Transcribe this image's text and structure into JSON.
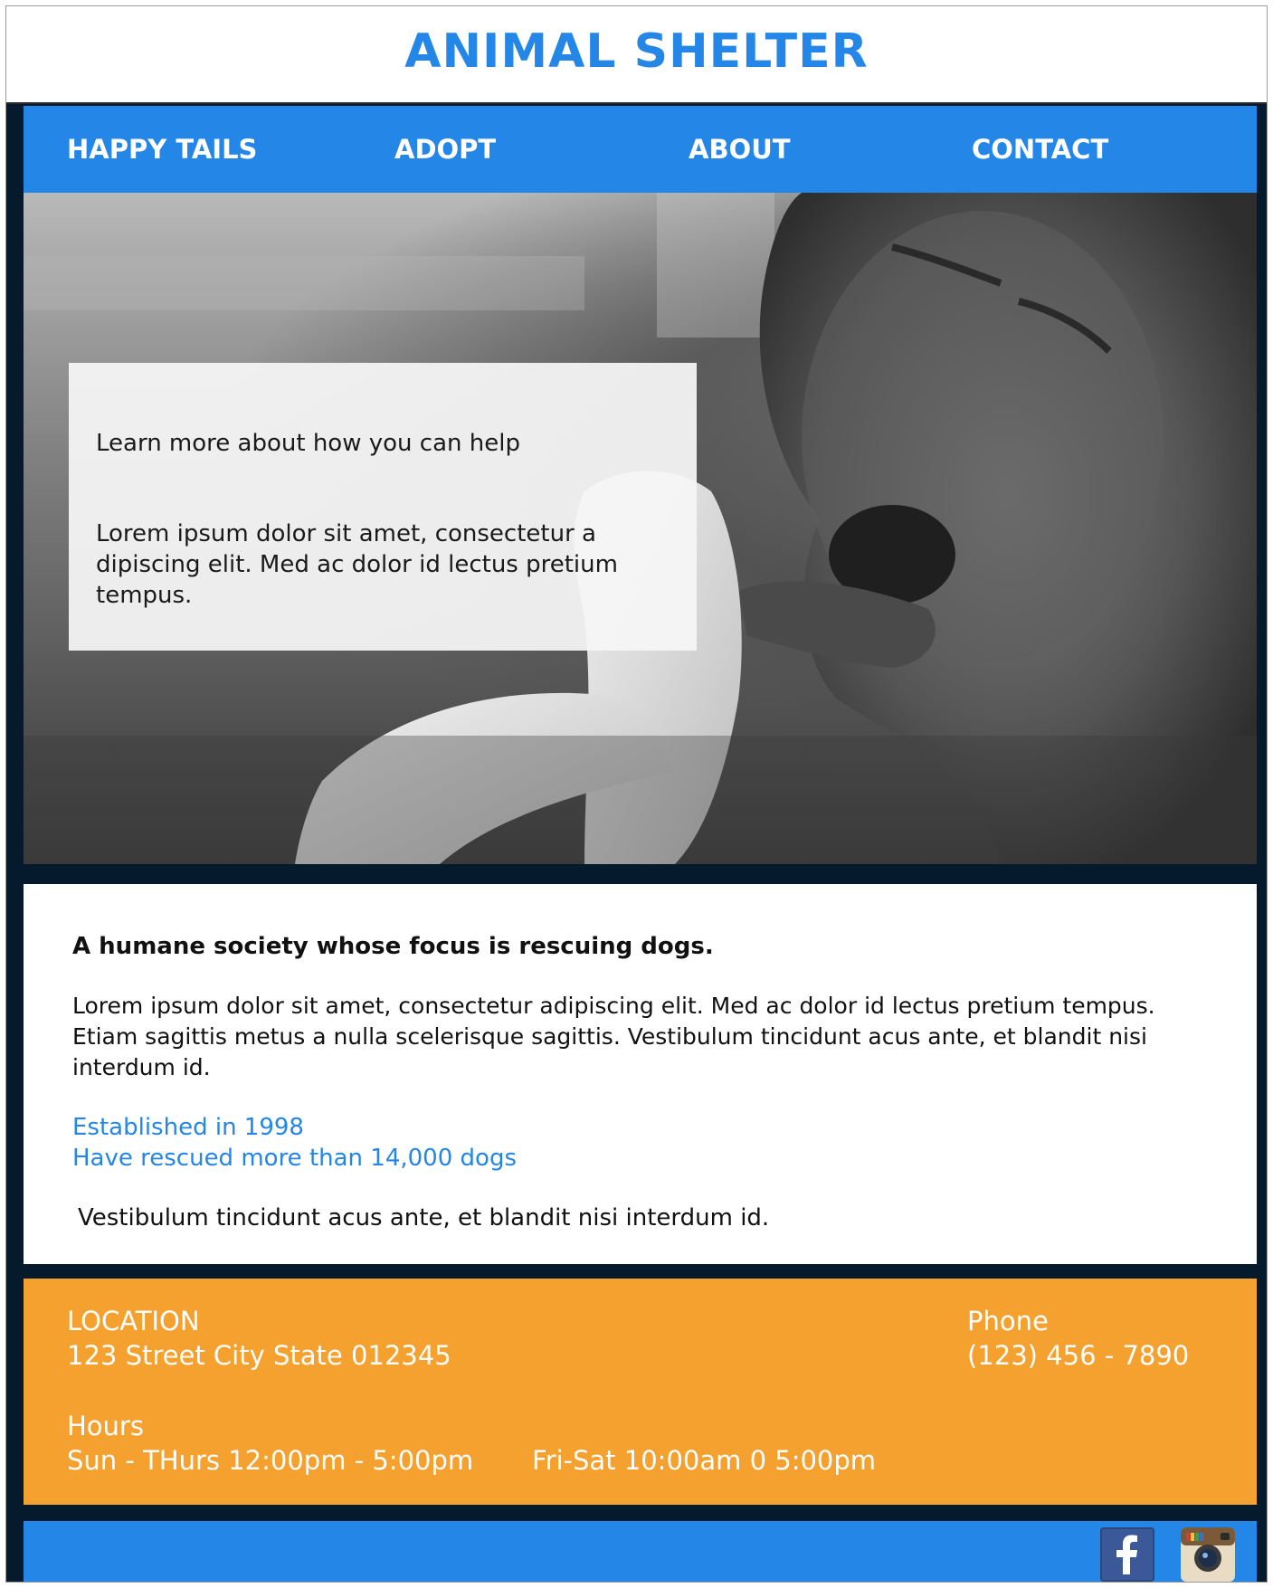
{
  "header": {
    "title": "ANIMAL SHELTER"
  },
  "nav": {
    "items": [
      {
        "label": "HAPPY TAILS"
      },
      {
        "label": "ADOPT"
      },
      {
        "label": "ABOUT"
      },
      {
        "label": "CONTACT"
      }
    ]
  },
  "hero": {
    "image": "grayscale photo of a dog chewing a stick on grass",
    "card": {
      "heading": "Learn more about how you can help",
      "text": "Lorem ipsum dolor sit amet, consectetur a dipiscing elit. Med ac dolor id lectus pretium tempus."
    }
  },
  "about": {
    "heading": "A humane society whose focus is rescuing dogs.",
    "body": "Lorem ipsum dolor sit amet, consectetur adipiscing elit. Med ac dolor id lectus pretium tempus. Etiam sagittis metus a nulla scelerisque sagittis. Vestibulum tincidunt acus ante, et blandit nisi interdum id.",
    "stats": [
      "Established in 1998",
      "Have rescued more than 14,000 dogs"
    ],
    "closing": "Vestibulum tincidunt acus ante, et blandit nisi interdum id."
  },
  "info": {
    "location_label": "LOCATION",
    "location_value": "123 Street City State 012345",
    "phone_label": "Phone",
    "phone_value": "(123) 456 - 7890",
    "hours_label": "Hours",
    "hours_weekday": "Sun - THurs 12:00pm - 5:00pm",
    "hours_weekend": "Fri-Sat 10:00am 0 5:00pm"
  },
  "footer": {
    "icons": [
      "facebook-icon",
      "instagram-icon"
    ]
  },
  "colors": {
    "brand_blue": "#2486e6",
    "accent_orange": "#f4a12f",
    "dark_navy": "#061a2e"
  }
}
